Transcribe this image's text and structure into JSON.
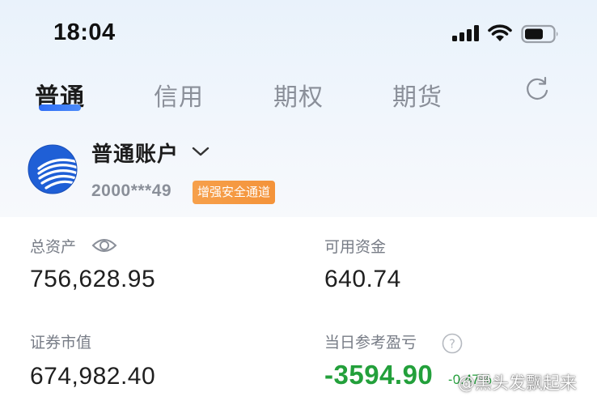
{
  "status_bar": {
    "time": "18:04"
  },
  "tabs": [
    {
      "label": "普通",
      "active": true
    },
    {
      "label": "信用",
      "active": false
    },
    {
      "label": "期权",
      "active": false
    },
    {
      "label": "期货",
      "active": false
    }
  ],
  "account": {
    "name": "普通账户",
    "number": "2000***49",
    "badge": "增强安全通道"
  },
  "assets": {
    "total_label": "总资产",
    "total_value": "756,628.95",
    "available_label": "可用资金",
    "available_value": "640.74",
    "market_value_label": "证券市值",
    "market_value": "674,982.40",
    "daily_pnl_label": "当日参考盈亏",
    "daily_pnl_value": "-3594.90",
    "daily_pnl_percent": "-0.47%"
  },
  "watermark": {
    "text": "@黑头发飘起来"
  },
  "colors": {
    "accent": "#2f6df6",
    "badge": "#f4993f",
    "loss_green": "#23a03b",
    "header_bg": "#edf4fb"
  },
  "icons": [
    "signal-icon",
    "wifi-icon",
    "battery-icon",
    "refresh-icon",
    "chevron-down-icon",
    "eye-icon",
    "help-icon"
  ]
}
